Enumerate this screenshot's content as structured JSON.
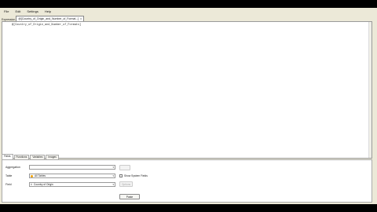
{
  "menu": [
    "File",
    "Edit",
    "Settings",
    "Help"
  ],
  "header": {
    "expression_label": "Expression",
    "field_tab": "@[Country_of_Origin_and_Number_of_Format...]",
    "tab_close": "x"
  },
  "editor": {
    "text": "@[Country_of_Origin_and_Number_of_Formats]"
  },
  "bottom_tabs": [
    "Fields",
    "Functions",
    "Variables",
    "Images"
  ],
  "panel": {
    "aggregation_label": "Aggregation",
    "aggregation_value": "",
    "table_label": "Table",
    "table_value": "All Tables",
    "field_label": "Field",
    "field_value": "Country of Origin",
    "show_system_fields": "Show System Fields",
    "paste_button": "Paste",
    "disabled_button_1": "",
    "disabled_button_2": "Options"
  },
  "footer": {
    "ok": "OK",
    "cancel": "Cancel",
    "help": "Help"
  }
}
